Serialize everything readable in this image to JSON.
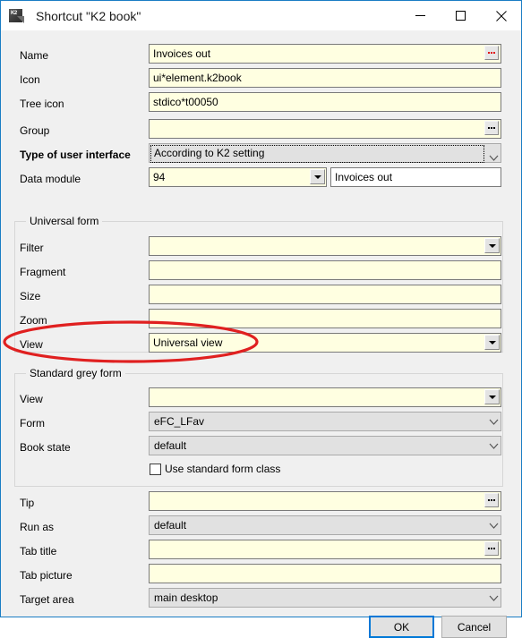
{
  "window": {
    "title": "Shortcut \"K2 book\"",
    "icon": "k2-book-icon",
    "icon_text": "K2",
    "accent_color": "#1a7dc4",
    "background_color": "#f0f0f0",
    "controls": {
      "minimize": "minimize-icon",
      "maximize": "maximize-icon",
      "close": "close-icon"
    }
  },
  "fields": {
    "name": {
      "label": "Name",
      "value": "Invoices out",
      "button": "ellipsis-button",
      "button_color": "#e01010"
    },
    "icon": {
      "label": "Icon",
      "value": "ui*element.k2book"
    },
    "tree_icon": {
      "label": "Tree icon",
      "value": "stdico*t00050"
    },
    "group": {
      "label": "Group",
      "value": "",
      "button": "ellipsis-button",
      "button_color": "#000000"
    },
    "type_of_user_interface": {
      "label": "Type of user interface",
      "value": "According to K2 setting"
    },
    "data_module": {
      "label": "Data module",
      "value": "94",
      "secondary_value": "Invoices out"
    }
  },
  "universal_form": {
    "title": "Universal form",
    "filter": {
      "label": "Filter",
      "value": ""
    },
    "fragment": {
      "label": "Fragment",
      "value": ""
    },
    "size": {
      "label": "Size",
      "value": ""
    },
    "zoom": {
      "label": "Zoom",
      "value": ""
    },
    "view": {
      "label": "View",
      "value": "Universal view"
    }
  },
  "standard_grey_form": {
    "title": "Standard grey form",
    "view": {
      "label": "View",
      "value": ""
    },
    "form": {
      "label": "Form",
      "value": "eFC_LFav"
    },
    "book_state": {
      "label": "Book state",
      "value": "default"
    },
    "use_standard_form_class": {
      "label": "Use standard form class",
      "checked": false
    }
  },
  "bottom_fields": {
    "tip": {
      "label": "Tip",
      "value": "",
      "button": "ellipsis-button"
    },
    "run_as": {
      "label": "Run as",
      "value": "default"
    },
    "tab_title": {
      "label": "Tab title",
      "value": "",
      "button": "ellipsis-button"
    },
    "tab_picture": {
      "label": "Tab picture",
      "value": ""
    },
    "target_area": {
      "label": "Target area",
      "value": "main desktop"
    }
  },
  "actions": {
    "ok": "OK",
    "cancel": "Cancel"
  },
  "annotation": {
    "type": "red-ellipse-highlight",
    "color": "#e02020",
    "target": "View field in Universal form"
  }
}
